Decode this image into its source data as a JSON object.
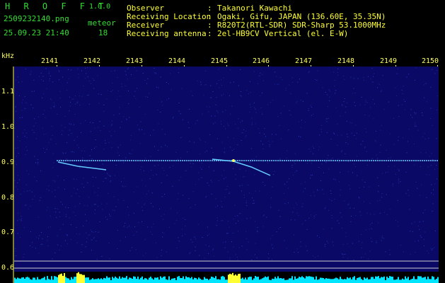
{
  "app": {
    "name": "H R O F F T",
    "version": "1.0.0"
  },
  "file": {
    "name": "2509232140.png",
    "datetime": "25.09.23 21:40"
  },
  "counter": {
    "label": "meteor",
    "value": "18"
  },
  "info": [
    {
      "label": "Observer",
      "value": "Takanori Kawachi"
    },
    {
      "label": "Receiving Location",
      "value": "Ogaki, Gifu, JAPAN (136.60E, 35.35N)"
    },
    {
      "label": "Receiver",
      "value": "R820T2(RTL-SDR) SDR-Sharp 53.1000MHz"
    },
    {
      "label": "Receiving antenna",
      "value": "2el-HB9CV Vertical (el. E-W)"
    }
  ],
  "x_ticks": [
    "2141",
    "2142",
    "2143",
    "2144",
    "2145",
    "2146",
    "2147",
    "2148",
    "2149",
    "2150"
  ],
  "y_axis": {
    "unit": "kHz",
    "ticks": [
      "1.1",
      "1.0",
      "0.9",
      "0.8",
      "0.7",
      "0.6"
    ]
  },
  "colors": {
    "header_text": "#33dd33",
    "info_value": "#ffff33",
    "axis": "#ffff66",
    "spectrum_bg": "#0a0a66",
    "signal": "#66ccff",
    "level": "#00e5ff"
  },
  "chart_data": {
    "type": "heatmap",
    "x_unit": "time (HHMM)",
    "y_unit": "kHz",
    "xlim": [
      2141,
      2150
    ],
    "ylim": [
      0.6,
      1.15
    ],
    "carrier_line_khz": 0.905,
    "echoes": [
      {
        "x_start": 2141.1,
        "x_end": 2141.8,
        "y_start": 0.9,
        "y_end": 0.88
      },
      {
        "x_start": 2144.8,
        "x_end": 2146.1,
        "y_start": 0.91,
        "y_end": 0.86
      }
    ]
  }
}
